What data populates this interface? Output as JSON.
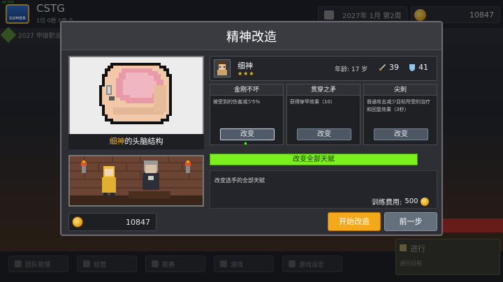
{
  "fps": "60 FPS",
  "header": {
    "logo_text": "SUMER",
    "team_name": "CSTG",
    "team_sub": "1位 0胜 0负 0",
    "date": "2027年 1月 第2周",
    "money": "10847",
    "league": "2027 甲级职业"
  },
  "bottom_nav": [
    "团队管理",
    "经营",
    "联赛",
    "游戏",
    "游戏设定"
  ],
  "proceed": {
    "label": "进行",
    "sub": "进行日程"
  },
  "dialog": {
    "title": "精神改造",
    "brain_caption_highlight": "细神",
    "brain_caption_rest": "的头脑结构",
    "coins": "10847",
    "player": {
      "name": "细神",
      "stars": "★★★",
      "age": "年龄: 17 岁",
      "attack": "39",
      "defense": "41"
    },
    "talents": [
      {
        "title": "金刚不坏",
        "desc": "被受到的伤害减少5%",
        "button": "改变"
      },
      {
        "title": "贯穿之矛",
        "desc": "获得穿甲效果（10）",
        "button": "改变"
      },
      {
        "title": "尖刺",
        "desc": "普通攻击减少目标所受的治疗和回复效果（3秒）",
        "button": "改变"
      }
    ],
    "change_all": "改变全部天赋",
    "info_desc": "改变选手的全部天赋",
    "fee_label": "训练费用:",
    "fee_value": "500",
    "start_button": "开始改造",
    "prev_button": "前一步"
  },
  "colors": {
    "accent_orange": "#f4a81c",
    "accent_green": "#7cf01f",
    "highlight_name": "#f0b020",
    "star": "#f0c020"
  }
}
